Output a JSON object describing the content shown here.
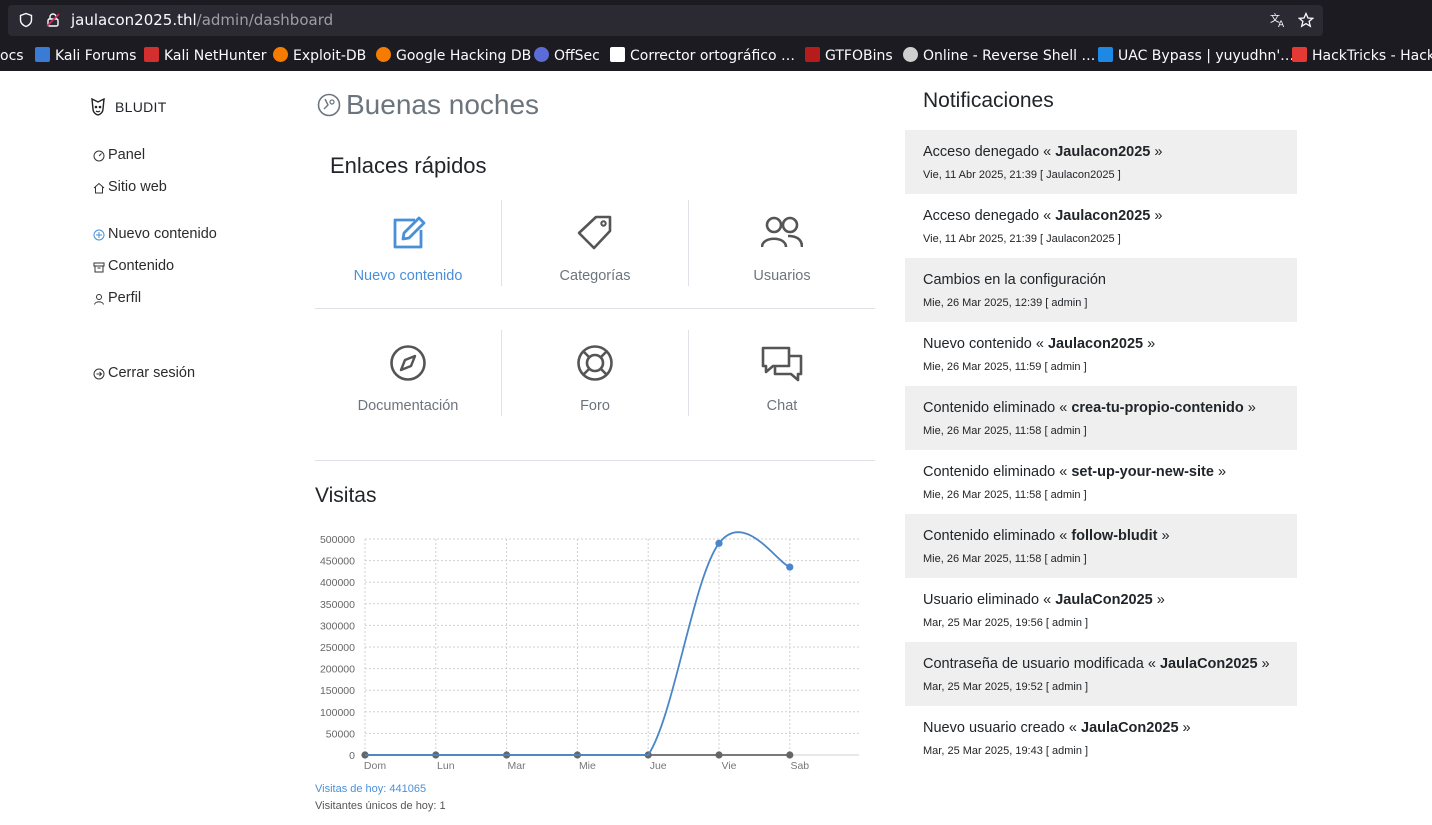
{
  "browser": {
    "url_host": "jaulacon2025.thl",
    "url_path": "/admin/dashboard",
    "bookmarks": [
      {
        "label": "ocs",
        "color": ""
      },
      {
        "label": "Kali Forums",
        "color": "#3a7bd5"
      },
      {
        "label": "Kali NetHunter",
        "color": "#d32f2f"
      },
      {
        "label": "Exploit-DB",
        "color": "#f57c00"
      },
      {
        "label": "Google Hacking DB",
        "color": "#f57c00"
      },
      {
        "label": "OffSec",
        "color": "#5b6bd8"
      },
      {
        "label": "Corrector ortográfico …",
        "color": "#ffffff"
      },
      {
        "label": "GTFOBins",
        "color": "#b71c1c"
      },
      {
        "label": "Online - Reverse Shell …",
        "color": "#cfcfcf"
      },
      {
        "label": "UAC Bypass | yuyudhn'…",
        "color": "#1e88e5"
      },
      {
        "label": "HackTricks - HackT",
        "color": "#e53935"
      }
    ]
  },
  "sidebar": {
    "brand": "BLUDIT",
    "items": [
      {
        "label": "Panel",
        "icon": "dashboard-icon"
      },
      {
        "label": "Sitio web",
        "icon": "home-icon"
      },
      {
        "label": "Nuevo contenido",
        "icon": "plus-circle-icon"
      },
      {
        "label": "Contenido",
        "icon": "archive-icon"
      },
      {
        "label": "Perfil",
        "icon": "user-icon"
      },
      {
        "label": "Cerrar sesión",
        "icon": "logout-icon"
      }
    ]
  },
  "main": {
    "greeting": "Buenas noches",
    "quick_links_title": "Enlaces rápidos",
    "quick_links": [
      {
        "label": "Nuevo contenido",
        "icon": "edit-icon"
      },
      {
        "label": "Categorías",
        "icon": "tag-icon"
      },
      {
        "label": "Usuarios",
        "icon": "users-icon"
      },
      {
        "label": "Documentación",
        "icon": "compass-icon"
      },
      {
        "label": "Foro",
        "icon": "lifebuoy-icon"
      },
      {
        "label": "Chat",
        "icon": "chat-icon"
      }
    ],
    "visits_title": "Visitas",
    "visits_today": "Visitas de hoy: 441065",
    "unique_today": "Visitantes únicos de hoy: 1"
  },
  "chart_data": {
    "type": "line",
    "categories": [
      "Dom",
      "Lun",
      "Mar",
      "Mie",
      "Jue",
      "Vie",
      "Sab"
    ],
    "series": [
      {
        "name": "",
        "values": [
          0,
          0,
          0,
          0,
          0,
          490000,
          435000
        ],
        "color": "#4a86c8"
      },
      {
        "name": "",
        "values": [
          0,
          0,
          0,
          0,
          0,
          0,
          0
        ],
        "color": "#666666"
      }
    ],
    "ylim": [
      0,
      500000
    ],
    "yticks": [
      0,
      50000,
      100000,
      150000,
      200000,
      250000,
      300000,
      350000,
      400000,
      450000,
      500000
    ],
    "grid": true
  },
  "notifications": {
    "title": "Notificaciones",
    "items": [
      {
        "pre": "Acceso denegado « ",
        "bold": "Jaulacon2025",
        "post": " »",
        "date": "Vie, 11 Abr 2025, 21:39 [ Jaulacon2025 ]"
      },
      {
        "pre": "Acceso denegado « ",
        "bold": "Jaulacon2025",
        "post": " »",
        "date": "Vie, 11 Abr 2025, 21:39 [ Jaulacon2025 ]"
      },
      {
        "pre": "Cambios en la configuración",
        "bold": "",
        "post": "",
        "date": "Mie, 26 Mar 2025, 12:39 [ admin ]"
      },
      {
        "pre": "Nuevo contenido « ",
        "bold": "Jaulacon2025",
        "post": " »",
        "date": "Mie, 26 Mar 2025, 11:59 [ admin ]"
      },
      {
        "pre": "Contenido eliminado « ",
        "bold": "crea-tu-propio-contenido",
        "post": " »",
        "date": "Mie, 26 Mar 2025, 11:58 [ admin ]"
      },
      {
        "pre": "Contenido eliminado « ",
        "bold": "set-up-your-new-site",
        "post": " »",
        "date": "Mie, 26 Mar 2025, 11:58 [ admin ]"
      },
      {
        "pre": "Contenido eliminado « ",
        "bold": "follow-bludit",
        "post": " »",
        "date": "Mie, 26 Mar 2025, 11:58 [ admin ]"
      },
      {
        "pre": "Usuario eliminado « ",
        "bold": "JaulaCon2025",
        "post": " »",
        "date": "Mar, 25 Mar 2025, 19:56 [ admin ]"
      },
      {
        "pre": "Contraseña de usuario modificada « ",
        "bold": "JaulaCon2025",
        "post": " »",
        "date": "Mar, 25 Mar 2025, 19:52 [ admin ]"
      },
      {
        "pre": "Nuevo usuario creado « ",
        "bold": "JaulaCon2025",
        "post": " »",
        "date": "Mar, 25 Mar 2025, 19:43 [ admin ]"
      }
    ]
  }
}
